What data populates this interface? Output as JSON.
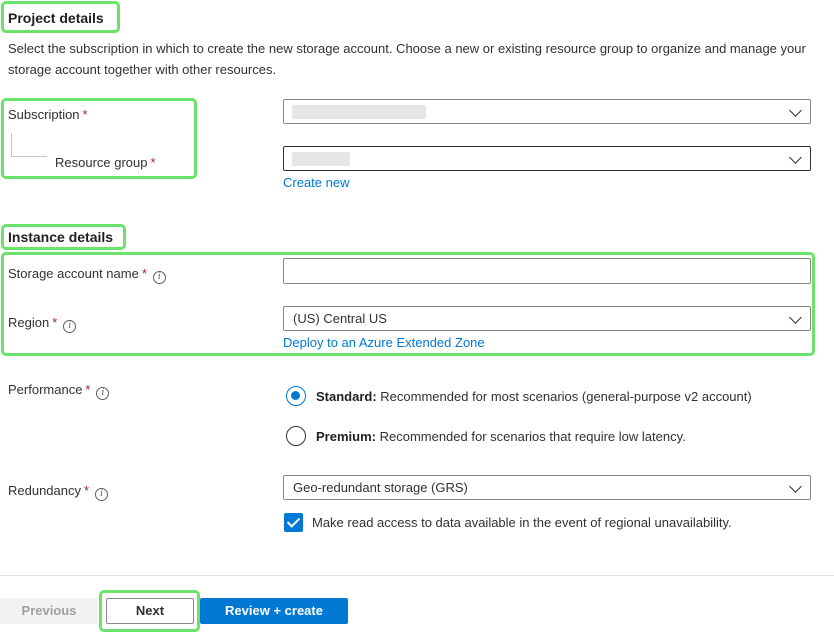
{
  "project": {
    "title": "Project details",
    "description": "Select the subscription in which to create the new storage account. Choose a new or existing resource group to organize and manage your storage account together with other resources.",
    "subscription_label": "Subscription",
    "resource_group_label": "Resource group",
    "create_new_link": "Create new"
  },
  "instance": {
    "title": "Instance details",
    "storage_name_label": "Storage account name",
    "storage_name_value": "",
    "region_label": "Region",
    "region_value": "(US) Central US",
    "extended_zone_link": "Deploy to an Azure Extended Zone"
  },
  "performance": {
    "label": "Performance",
    "options": [
      {
        "name": "Standard:",
        "desc": "Recommended for most scenarios (general-purpose v2 account)",
        "selected": true
      },
      {
        "name": "Premium:",
        "desc": "Recommended for scenarios that require low latency.",
        "selected": false
      }
    ]
  },
  "redundancy": {
    "label": "Redundancy",
    "value": "Geo-redundant storage (GRS)",
    "checkbox_label": "Make read access to data available in the event of regional unavailability.",
    "checkbox_checked": true
  },
  "required_marker": "*",
  "info_glyph": "i",
  "footer": {
    "previous": "Previous",
    "next": "Next",
    "review_create": "Review + create"
  },
  "colors": {
    "accent": "#0078d4",
    "highlight": "#6be36b",
    "required": "#a4262c"
  }
}
